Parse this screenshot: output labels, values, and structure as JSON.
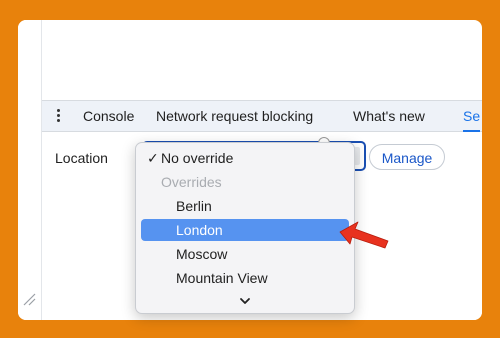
{
  "tabs": [
    {
      "label": "Console"
    },
    {
      "label": "Network request blocking"
    },
    {
      "label": "What's new"
    },
    {
      "label": "Se"
    }
  ],
  "sensors": {
    "location_label": "Location",
    "manage_label": "Manage"
  },
  "dropdown": {
    "checked_option": "No override",
    "group_label": "Overrides",
    "options": [
      "Berlin",
      "London",
      "Moscow",
      "Mountain View"
    ],
    "highlighted": "London"
  },
  "colors": {
    "frame": "#E8820C",
    "highlight": "#5693f0",
    "accent": "#1a73e8",
    "arrow": "#e8321f"
  }
}
